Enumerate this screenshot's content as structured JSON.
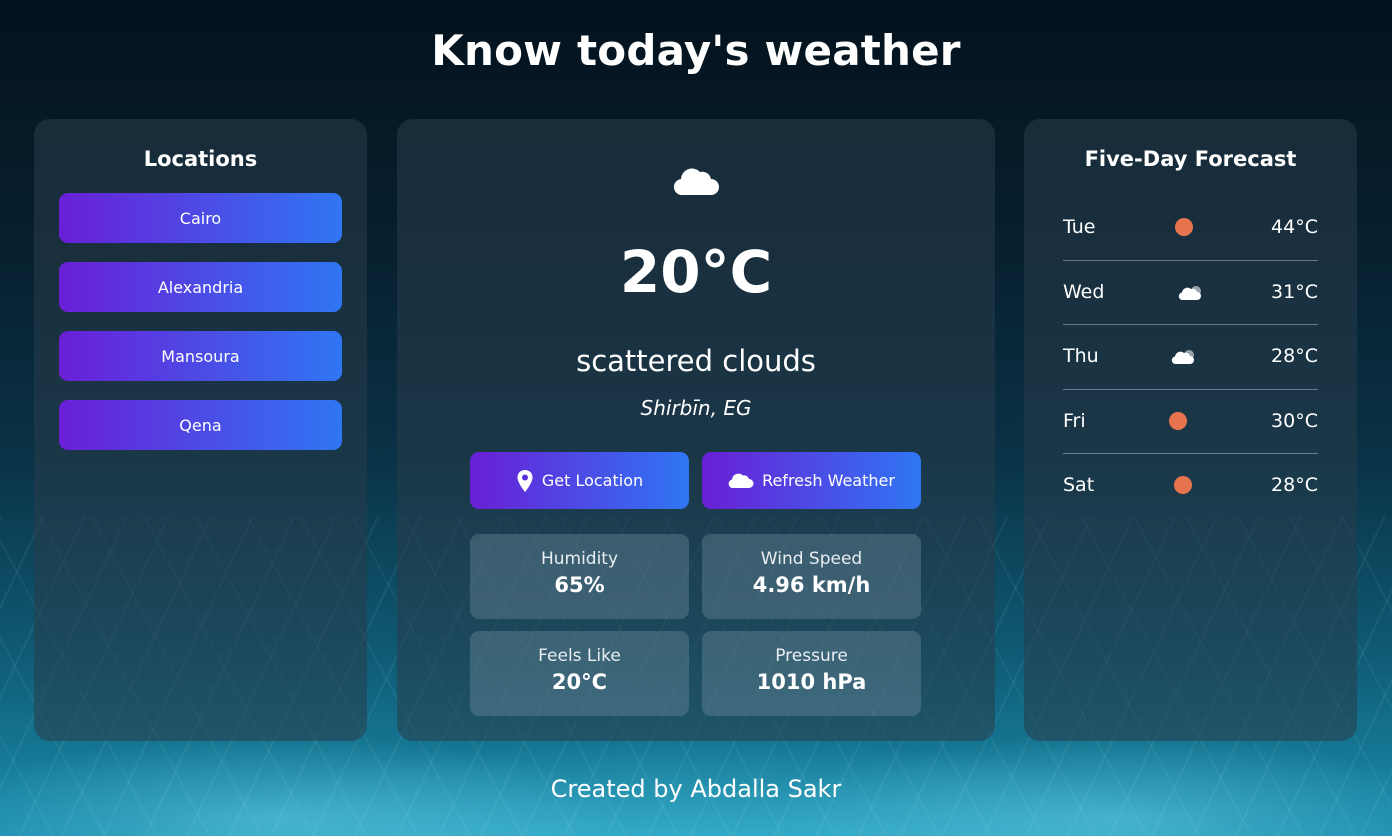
{
  "page": {
    "title": "Know today's weather",
    "footer": "Created by Abdalla Sakr"
  },
  "locations": {
    "title": "Locations",
    "items": [
      "Cairo",
      "Alexandria",
      "Mansoura",
      "Qena"
    ]
  },
  "current": {
    "icon": "cloud-icon",
    "temperature": "20°C",
    "description": "scattered clouds",
    "place": "Shirbīn, EG",
    "actions": {
      "get_location": "Get Location",
      "refresh": "Refresh Weather"
    },
    "stats": {
      "humidity": {
        "label": "Humidity",
        "value": "65%"
      },
      "wind": {
        "label": "Wind Speed",
        "value": "4.96 km/h"
      },
      "feels_like": {
        "label": "Feels Like",
        "value": "20°C"
      },
      "pressure": {
        "label": "Pressure",
        "value": "1010 hPa"
      }
    }
  },
  "forecast": {
    "title": "Five-Day Forecast",
    "days": [
      {
        "day": "Tue",
        "icon": "sun-icon",
        "temp": "44°C"
      },
      {
        "day": "Wed",
        "icon": "cloud-icon",
        "temp": "31°C"
      },
      {
        "day": "Thu",
        "icon": "cloud-icon",
        "temp": "28°C"
      },
      {
        "day": "Fri",
        "icon": "sun-icon",
        "temp": "30°C"
      },
      {
        "day": "Sat",
        "icon": "sun-icon",
        "temp": "28°C"
      }
    ]
  },
  "colors": {
    "button_gradient_start": "#6a1fd6",
    "button_gradient_end": "#2f76f4",
    "sun": "#e8734f"
  }
}
